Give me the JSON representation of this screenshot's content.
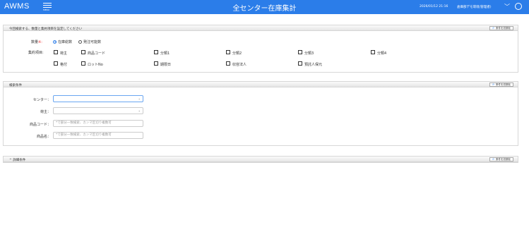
{
  "header": {
    "app_name": "AWMS",
    "menu_label": "MENU",
    "page_title": "全センター在庫集計",
    "datetime": "2026/01/12 21:16",
    "user": "倉庫部デモ環境(管理者)"
  },
  "search_section": {
    "title": "今回検索する、数量と集約項目を設定してください",
    "reset_label": "条件を初期化",
    "quantity_label": "数量",
    "quantity_required_mark": "※:",
    "quantity_options": [
      "在庫総数",
      "発注可能数"
    ],
    "aggregation_label": "集約項目:",
    "checkboxes_row1": [
      "荷主",
      "商品コード",
      "分類1",
      "分類2",
      "分類3",
      "分類4"
    ],
    "checkboxes_row2": [
      "格付",
      "ロットNo",
      "期限日",
      "収容法人",
      "預託人保元"
    ]
  },
  "conditions_section": {
    "title": "検索条件",
    "reset_label": "条件を初期化",
    "center_label": "センター：",
    "owner_label": "荷主：",
    "product_code_label": "商品コード：",
    "product_code_placeholder": "*で部分一致検索、カンマ区切り複数可",
    "product_name_label": "商品名：",
    "product_name_placeholder": "*で部分一致検索、カンマ区切り複数可"
  },
  "detail_section": {
    "title": "^ 詳細条件",
    "reset_label": "条件を初期化"
  }
}
